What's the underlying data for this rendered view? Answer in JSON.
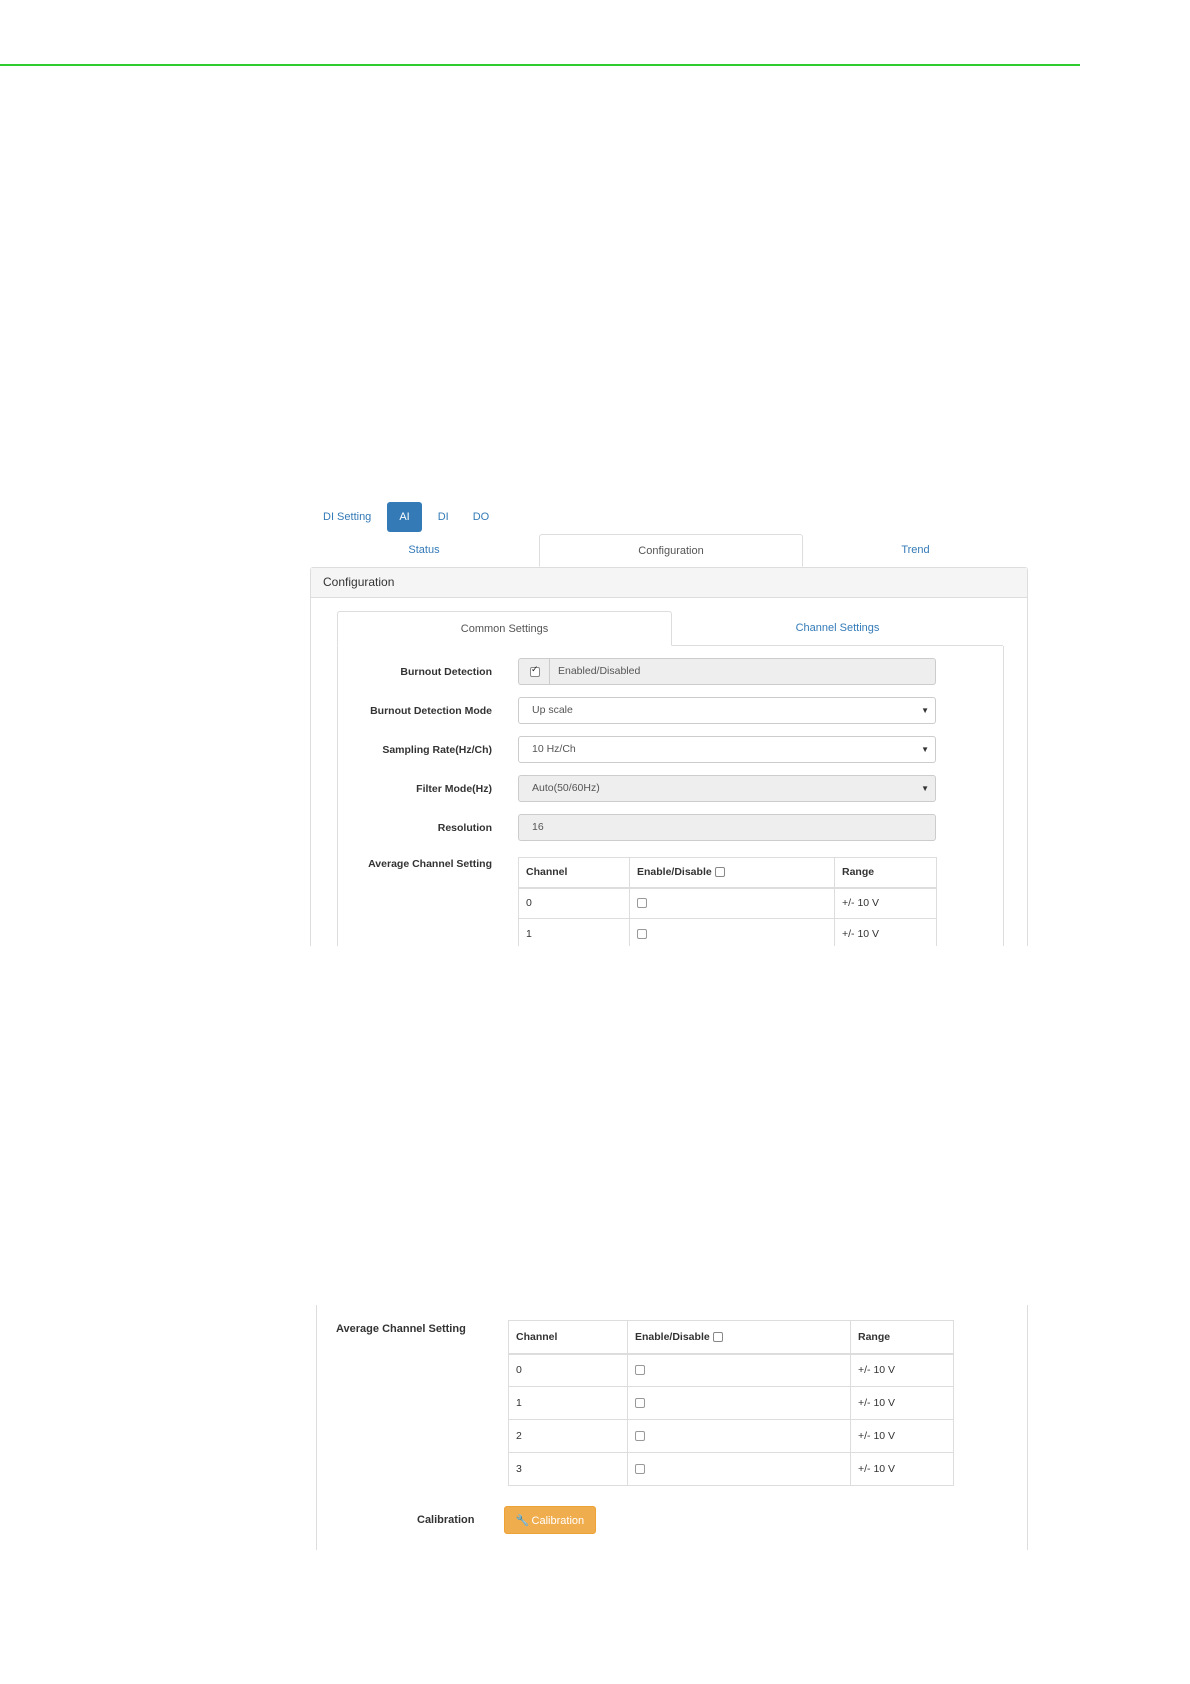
{
  "screen1": {
    "pills": [
      "DI Setting",
      "AI",
      "DI",
      "DO"
    ],
    "active_pill": "AI",
    "main_tabs": [
      "Status",
      "Configuration",
      "Trend"
    ],
    "panel_title": "Configuration",
    "sub_tabs": [
      "Common Settings",
      "Channel Settings"
    ],
    "fields": {
      "burnout_detection": {
        "label": "Burnout Detection",
        "value": "Enabled/Disabled",
        "checked": true
      },
      "burnout_mode": {
        "label": "Burnout Detection Mode",
        "value": "Up scale"
      },
      "sampling_rate": {
        "label": "Sampling Rate(Hz/Ch)",
        "value": "10 Hz/Ch"
      },
      "filter_mode": {
        "label": "Filter Mode(Hz)",
        "value": "Auto(50/60Hz)"
      },
      "resolution": {
        "label": "Resolution",
        "value": "16"
      },
      "average_channel": {
        "label": "Average Channel Setting"
      }
    },
    "table": {
      "headers": [
        "Channel",
        "Enable/Disable",
        "Range"
      ],
      "rows": [
        {
          "channel": "0",
          "range": "+/- 10 V"
        },
        {
          "channel": "1",
          "range": "+/- 10 V"
        }
      ]
    }
  },
  "screen2": {
    "average_label": "Average Channel Setting",
    "table": {
      "headers": [
        "Channel",
        "Enable/Disable",
        "Range"
      ],
      "rows": [
        {
          "channel": "0",
          "range": "+/- 10 V"
        },
        {
          "channel": "1",
          "range": "+/- 10 V"
        },
        {
          "channel": "2",
          "range": "+/- 10 V"
        },
        {
          "channel": "3",
          "range": "+/- 10 V"
        }
      ]
    },
    "calibration_label": "Calibration",
    "calibration_button": "Calibration"
  },
  "colors": {
    "rule": "#2ecc2e",
    "primary": "#337ab7",
    "warning": "#f0ad4e"
  }
}
